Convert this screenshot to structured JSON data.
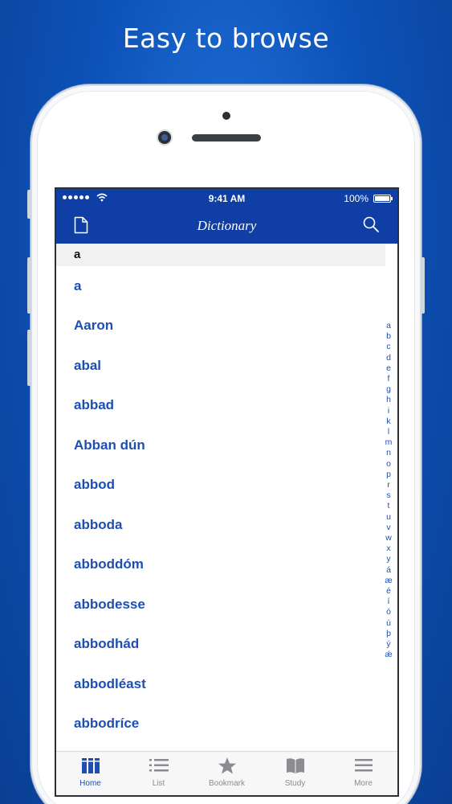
{
  "promo": {
    "title": "Easy to browse"
  },
  "status_bar": {
    "time": "9:41 AM",
    "battery": "100%"
  },
  "nav": {
    "title": "Dictionary",
    "left_icon": "document-icon",
    "right_icon": "search-icon"
  },
  "section": {
    "header": "a"
  },
  "words": [
    "a",
    "Aaron",
    "abal",
    "abbad",
    "Abban dún",
    "abbod",
    "abboda",
    "abboddóm",
    "abbodesse",
    "abbodhád",
    "abbodléast",
    "abbodríce"
  ],
  "index_letters": [
    "a",
    "b",
    "c",
    "d",
    "e",
    "f",
    "g",
    "h",
    "i",
    "k",
    "l",
    "m",
    "n",
    "o",
    "p",
    "r",
    "s",
    "t",
    "u",
    "v",
    "w",
    "x",
    "y",
    "á",
    "æ",
    "é",
    "í",
    "ó",
    "ú",
    "þ",
    "ý",
    "ǽ"
  ],
  "tabs": [
    {
      "label": "Home",
      "icon": "books-icon",
      "active": true
    },
    {
      "label": "List",
      "icon": "list-icon",
      "active": false
    },
    {
      "label": "Bookmark",
      "icon": "star-icon",
      "active": false
    },
    {
      "label": "Study",
      "icon": "book-icon",
      "active": false
    },
    {
      "label": "More",
      "icon": "menu-icon",
      "active": false
    }
  ],
  "colors": {
    "accent": "#0f3ea4",
    "link": "#1d4fb3",
    "background": "#0d52b8"
  }
}
